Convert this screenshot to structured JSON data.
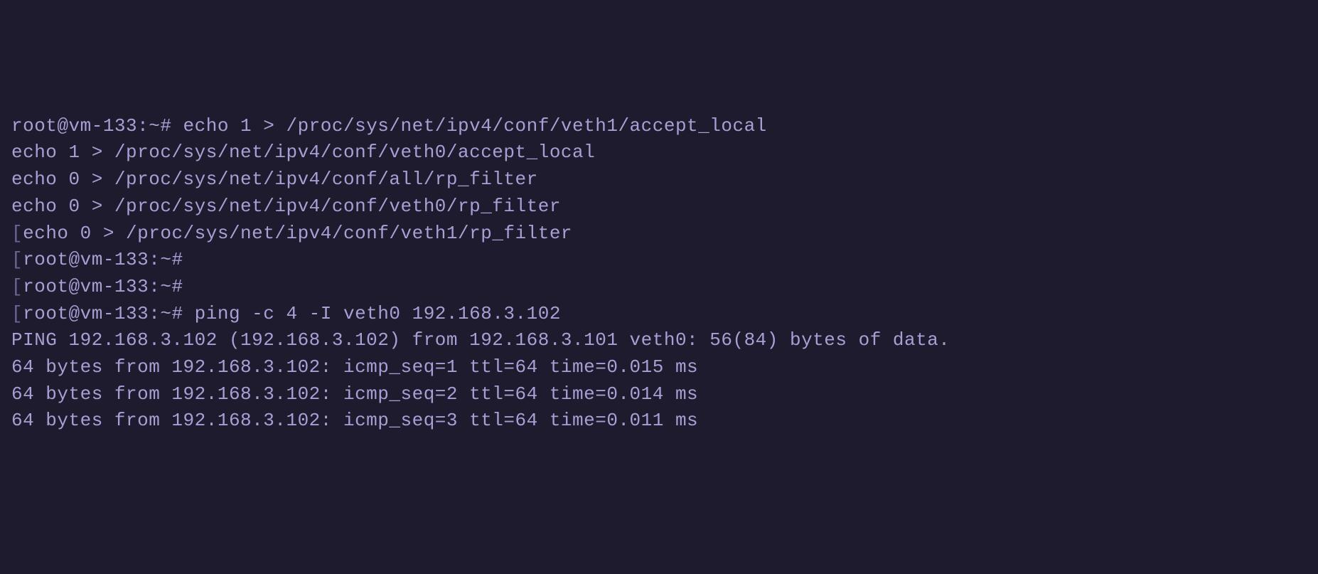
{
  "lines": [
    {
      "bracket": "",
      "prompt": "root@vm-133:~# ",
      "command": "echo 1 > /proc/sys/net/ipv4/conf/veth1/accept_local"
    },
    {
      "bracket": "",
      "prompt": "",
      "command": "echo 1 > /proc/sys/net/ipv4/conf/veth0/accept_local"
    },
    {
      "bracket": "",
      "prompt": "",
      "command": "echo 0 > /proc/sys/net/ipv4/conf/all/rp_filter"
    },
    {
      "bracket": "",
      "prompt": "",
      "command": "echo 0 > /proc/sys/net/ipv4/conf/veth0/rp_filter"
    },
    {
      "bracket": "[",
      "prompt": "",
      "command": "echo 0 > /proc/sys/net/ipv4/conf/veth1/rp_filter"
    },
    {
      "bracket": "[",
      "prompt": "root@vm-133:~# ",
      "command": ""
    },
    {
      "bracket": "[",
      "prompt": "root@vm-133:~# ",
      "command": ""
    },
    {
      "bracket": "[",
      "prompt": "root@vm-133:~# ",
      "command": "ping -c 4 -I veth0 192.168.3.102"
    },
    {
      "bracket": "",
      "prompt": "",
      "command": "PING 192.168.3.102 (192.168.3.102) from 192.168.3.101 veth0: 56(84) bytes of data."
    },
    {
      "bracket": "",
      "prompt": "",
      "command": "64 bytes from 192.168.3.102: icmp_seq=1 ttl=64 time=0.015 ms"
    },
    {
      "bracket": "",
      "prompt": "",
      "command": "64 bytes from 192.168.3.102: icmp_seq=2 ttl=64 time=0.014 ms"
    },
    {
      "bracket": "",
      "prompt": "",
      "command": "64 bytes from 192.168.3.102: icmp_seq=3 ttl=64 time=0.011 ms"
    }
  ]
}
